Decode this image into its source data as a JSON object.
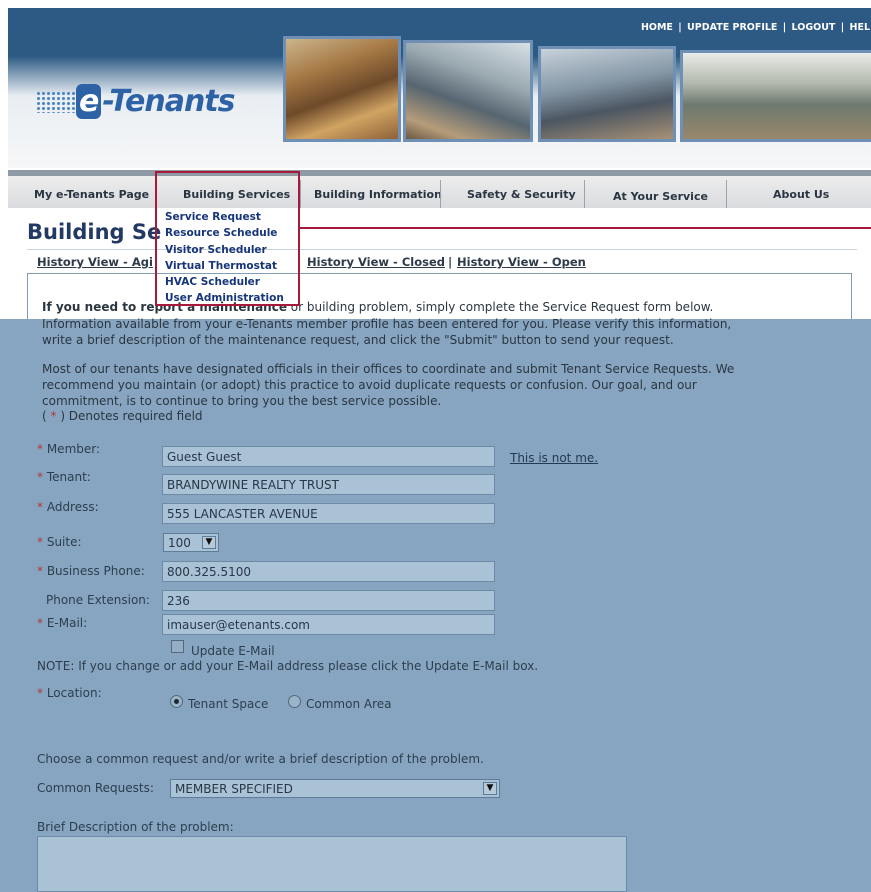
{
  "top_nav": {
    "home": "HOME",
    "update_profile": "UPDATE PROFILE",
    "logout": "LOGOUT",
    "help": "HEL",
    "separator": "|"
  },
  "brand": {
    "logo_e": "e",
    "logo_rest": "-Tenants"
  },
  "main_nav": {
    "items": [
      "My e-Tenants Page",
      "Building Services",
      "Building Information",
      "Safety & Security",
      "At Your Service",
      "About Us"
    ]
  },
  "dropdown": {
    "items": [
      "Service Request",
      "Resource Schedule",
      "Visitor Scheduler",
      "Virtual Thermostat",
      "HVAC Scheduler",
      "User Administration"
    ]
  },
  "page": {
    "title": "Building Se",
    "links": [
      "History View - Agi",
      "History View - Closed",
      "History View - Open"
    ],
    "link_separator": "|"
  },
  "intro": {
    "bold_lead": "If you need to report a maintenance",
    "line1_rest": " or building problem, simply complete the Service Request form below.",
    "line2": "Information available from your e-Tenants member profile has been entered for you. Please verify this information,",
    "line3": "write a brief description of the maintenance request, and click the \"Submit\" button to send your request.",
    "para2_line1": "Most of our tenants have designated officials in their offices to coordinate and submit Tenant Service Requests. We",
    "para2_line2": "recommend you maintain (or adopt) this practice to avoid duplicate requests or confusion. Our goal, and our",
    "para2_line3": "commitment, is to continue to bring you the best service possible.",
    "required_note_open": "( ",
    "required_star": "*",
    "required_note_close": " ) Denotes required field"
  },
  "form": {
    "star": "*",
    "member": {
      "label": "Member:",
      "value": "Guest Guest",
      "link": "This is not me."
    },
    "tenant": {
      "label": "Tenant:",
      "value": "BRANDYWINE REALTY TRUST"
    },
    "address": {
      "label": "Address:",
      "value": "555 LANCASTER AVENUE"
    },
    "suite": {
      "label": "Suite:",
      "value": "100"
    },
    "business_phone": {
      "label": "Business Phone:",
      "value": "800.325.5100"
    },
    "phone_extension": {
      "label": "Phone Extension:",
      "value": "236"
    },
    "email": {
      "label": "E-Mail:",
      "value": "imauser@etenants.com"
    },
    "update_email": {
      "label": "Update E-Mail",
      "checked": false
    },
    "email_note": "NOTE: If you change or add your E-Mail address please click the Update E-Mail box.",
    "location": {
      "label": "Location:",
      "options": [
        "Tenant Space",
        "Common Area"
      ],
      "selected": "Tenant Space"
    },
    "common_intro": "Choose a common request and/or write a brief description of the problem.",
    "common_requests": {
      "label": "Common Requests:",
      "value": "MEMBER SPECIFIED"
    },
    "description": {
      "label": "Brief Description of the problem:",
      "value": ""
    }
  },
  "colors": {
    "overlay": "#87a5c0",
    "highlight": "#a71a3b",
    "header_blue": "#2d5a84"
  }
}
